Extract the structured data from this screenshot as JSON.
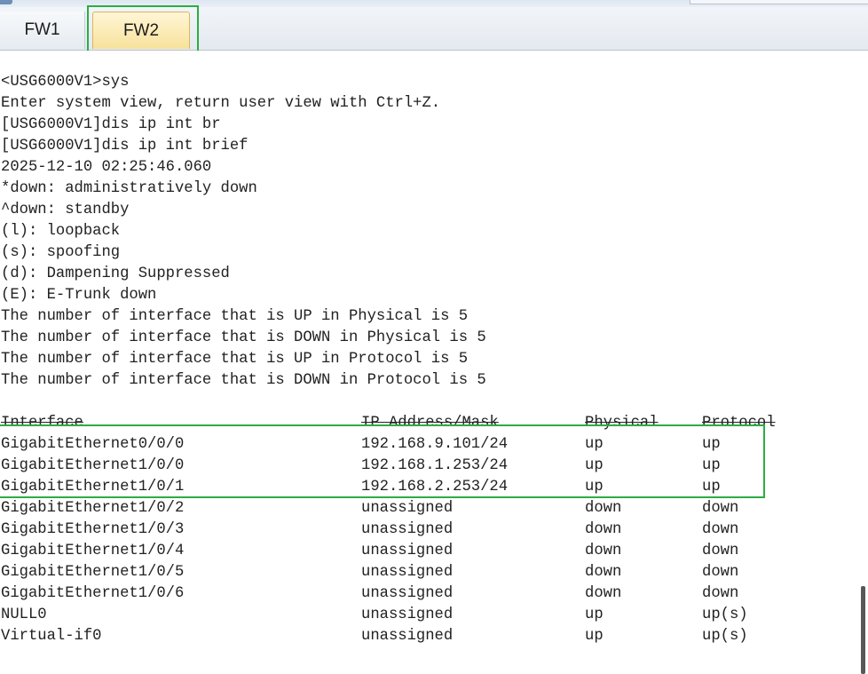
{
  "tabs": [
    {
      "label": "FW1",
      "active": false
    },
    {
      "label": "FW2",
      "active": true
    }
  ],
  "console": {
    "lines": [
      "<USG6000V1>sys",
      "Enter system view, return user view with Ctrl+Z.",
      "[USG6000V1]dis ip int br",
      "[USG6000V1]dis ip int brief",
      "2025-12-10 02:25:46.060",
      "*down: administratively down",
      "^down: standby",
      "(l): loopback",
      "(s): spoofing",
      "(d): Dampening Suppressed",
      "(E): E-Trunk down",
      "The number of interface that is UP in Physical is 5",
      "The number of interface that is DOWN in Physical is 5",
      "The number of interface that is UP in Protocol is 5",
      "The number of interface that is DOWN in Protocol is 5"
    ],
    "table": {
      "headers": [
        "Interface",
        "IP Address/Mask",
        "Physical",
        "Protocol"
      ],
      "rows": [
        [
          "GigabitEthernet0/0/0",
          "192.168.9.101/24",
          "up",
          "up"
        ],
        [
          "GigabitEthernet1/0/0",
          "192.168.1.253/24",
          "up",
          "up"
        ],
        [
          "GigabitEthernet1/0/1",
          "192.168.2.253/24",
          "up",
          "up"
        ],
        [
          "GigabitEthernet1/0/2",
          "unassigned",
          "down",
          "down"
        ],
        [
          "GigabitEthernet1/0/3",
          "unassigned",
          "down",
          "down"
        ],
        [
          "GigabitEthernet1/0/4",
          "unassigned",
          "down",
          "down"
        ],
        [
          "GigabitEthernet1/0/5",
          "unassigned",
          "down",
          "down"
        ],
        [
          "GigabitEthernet1/0/6",
          "unassigned",
          "down",
          "down"
        ],
        [
          "NULL0",
          "unassigned",
          "up",
          "up(s)"
        ],
        [
          "Virtual-if0",
          "unassigned",
          "up",
          "up(s)"
        ]
      ]
    }
  },
  "colors": {
    "highlight": "#2eac43",
    "active_tab": "#f7e29b",
    "text": "#222222"
  }
}
